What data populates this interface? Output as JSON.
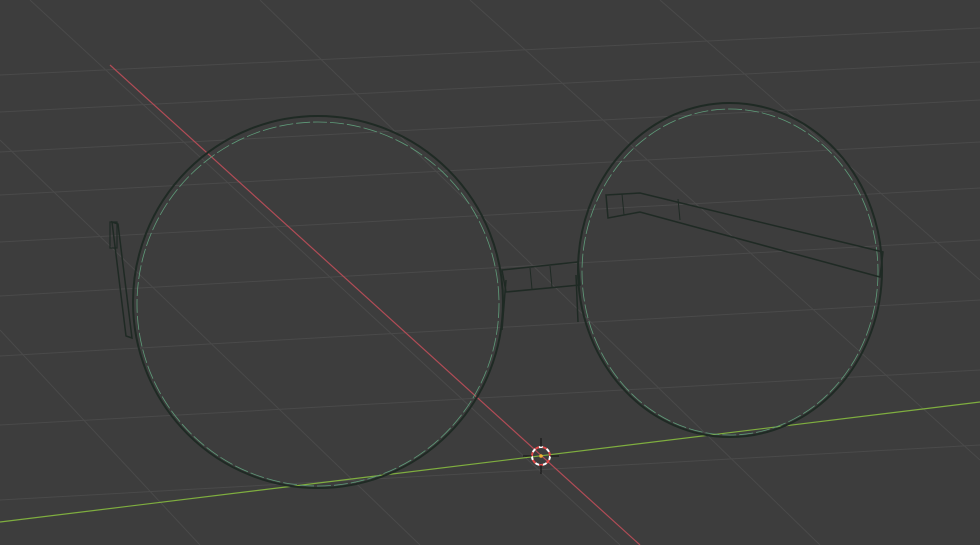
{
  "viewport": {
    "mode": "wireframe",
    "background_color": "#3d3d3d"
  },
  "grid": {
    "visible": true,
    "line_color": "#4a4a4a"
  },
  "axes": {
    "x_axis_color": "#b14c56",
    "y_axis_color": "#7fae3f"
  },
  "object": {
    "kind": "glasses",
    "wire_color": "#1f2a24",
    "edge_highlight_color": "#5f9c7a"
  },
  "cursor_3d": {
    "ring_color_a": "#e04a4a",
    "ring_color_b": "#ffffff",
    "center_color": "#f0b030"
  }
}
